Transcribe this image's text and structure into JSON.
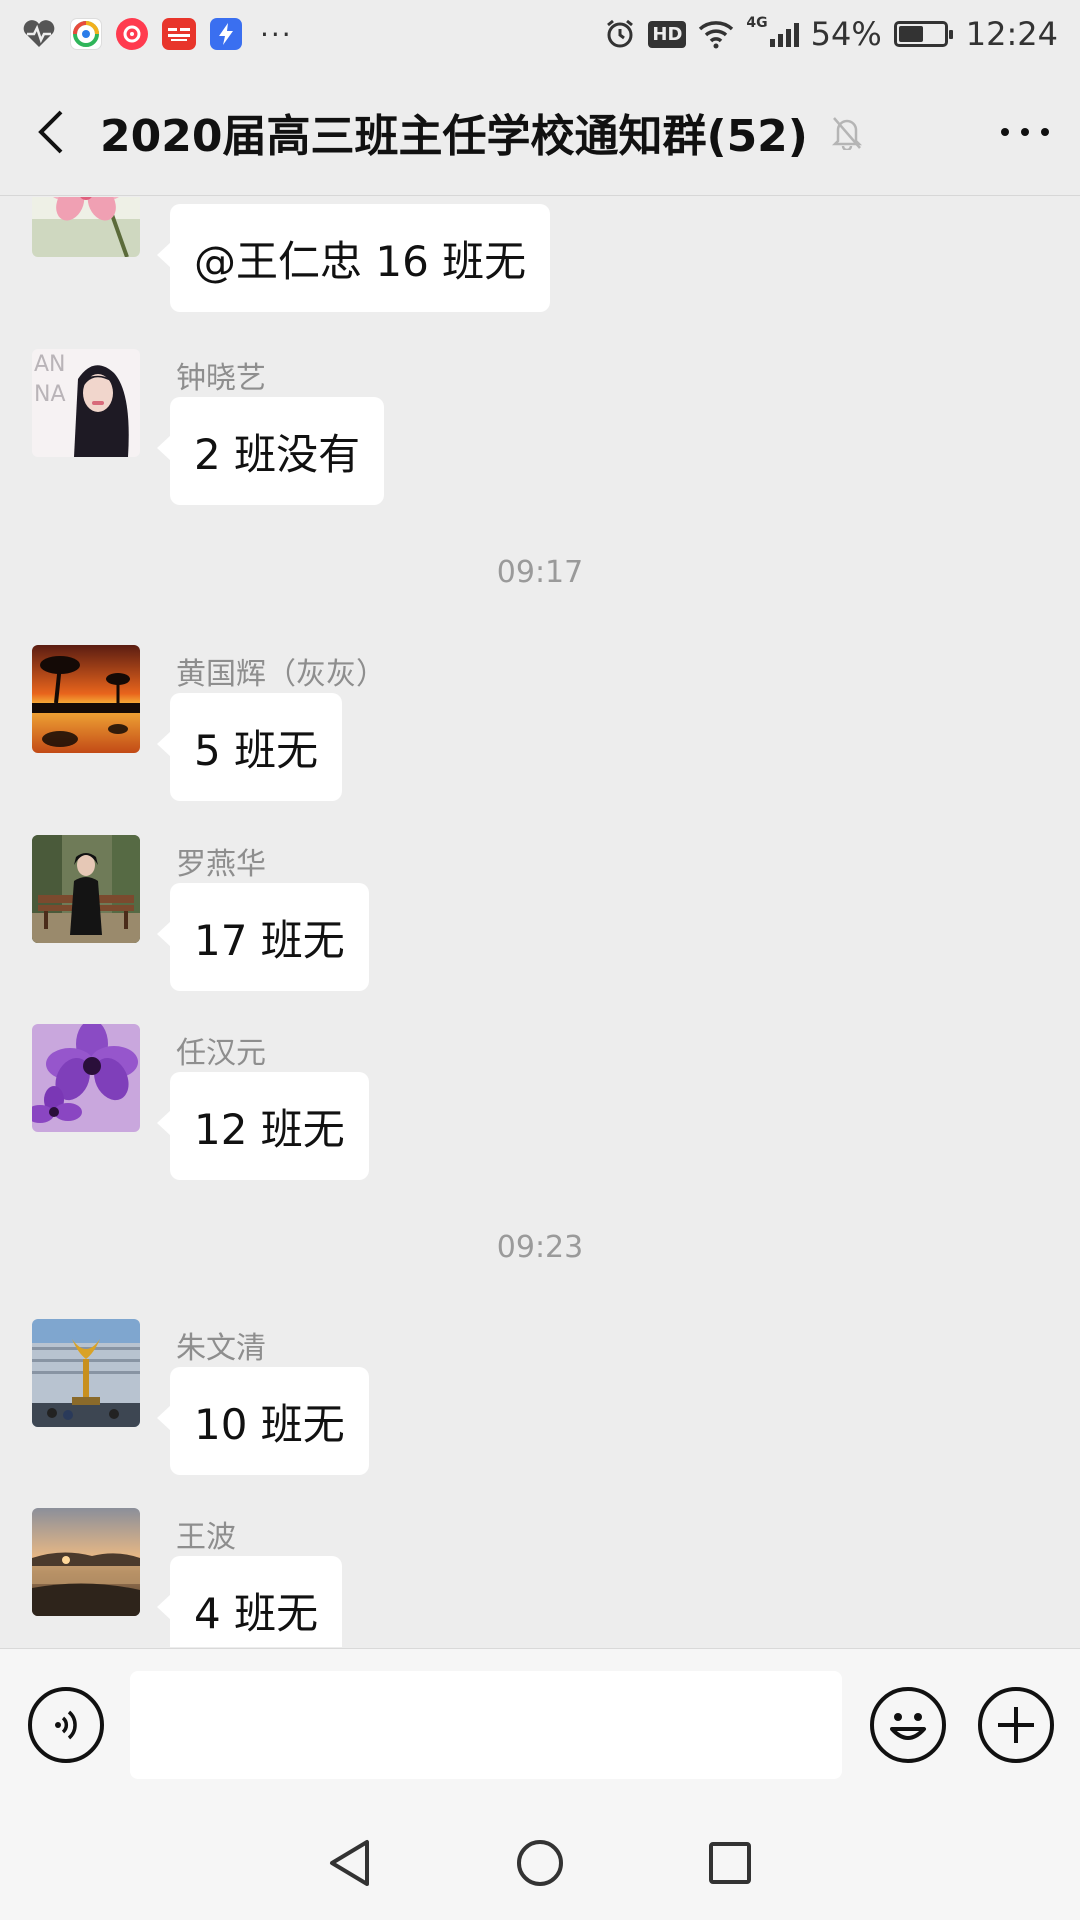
{
  "status_bar": {
    "app_icons": [
      {
        "name": "health-icon",
        "color": "#555555"
      },
      {
        "name": "browser-icon",
        "color": "#ffffff"
      },
      {
        "name": "video-app-icon",
        "color": "#ff3b4f"
      },
      {
        "name": "toutiao-icon",
        "color": "#e8352b"
      },
      {
        "name": "flash-app-icon",
        "color": "#3a6ff0"
      }
    ],
    "more_indicator": "···",
    "hd_badge": "HD",
    "network": "4G",
    "battery_percent": "54%",
    "battery_level": 0.54,
    "time": "12:24"
  },
  "header": {
    "title": "2020届高三班主任学校通知群(52)",
    "muted": true
  },
  "messages": [
    {
      "type": "message",
      "sender": "",
      "text": "@王仁忠  16 班无",
      "avatar": "pink-flower"
    },
    {
      "type": "message",
      "sender": "钟晓艺",
      "text": "2 班没有",
      "avatar": "woman-portrait",
      "avatar_text": [
        "AN",
        "NA"
      ]
    },
    {
      "type": "time",
      "text": "09:17"
    },
    {
      "type": "message",
      "sender": "黄国辉（灰灰）",
      "text": "5 班无",
      "avatar": "sunset-palms"
    },
    {
      "type": "message",
      "sender": "罗燕华",
      "text": "17 班无",
      "avatar": "person-bench"
    },
    {
      "type": "message",
      "sender": "任汉元",
      "text": "12 班无",
      "avatar": "purple-flower"
    },
    {
      "type": "time",
      "text": "09:23"
    },
    {
      "type": "message",
      "sender": "朱文清",
      "text": "10 班无",
      "avatar": "golden-statue"
    },
    {
      "type": "message",
      "sender": "王波",
      "text": "4 班无",
      "avatar": "lake-sunset"
    }
  ],
  "input_bar": {
    "value": ""
  },
  "colors": {
    "background": "#ededed",
    "bubble": "#ffffff",
    "secondary_text": "#8e8e8e"
  }
}
